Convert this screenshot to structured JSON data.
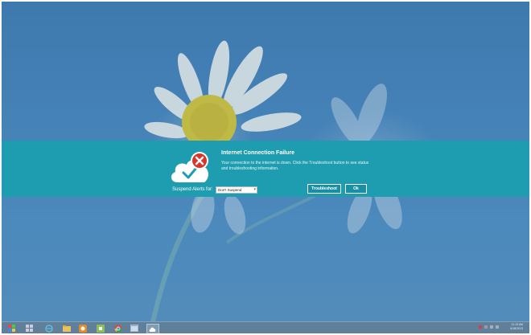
{
  "dialog": {
    "title": "Internet Connection Failure",
    "message": "Your connection to the internet is down. Click the Troubleshoot button to see status and troubleshooting information.",
    "suspend_label": "Suspend Alerts for:",
    "suspend_value": "Don't Suspend",
    "troubleshoot_label": "Troubleshoot",
    "ok_label": "Ok",
    "icon": "cloud-error-icon",
    "colors": {
      "banner": "#1f9db0",
      "error": "#d9342b"
    }
  },
  "taskbar": {
    "items": [
      "start-icon",
      "apps-grid-icon",
      "internet-explorer-icon",
      "folder-icon",
      "media-icon",
      "app-icon",
      "chrome-icon",
      "window-icon",
      "cloud-app-icon"
    ],
    "time": "11:13 AM",
    "date": "6/18/2013"
  }
}
